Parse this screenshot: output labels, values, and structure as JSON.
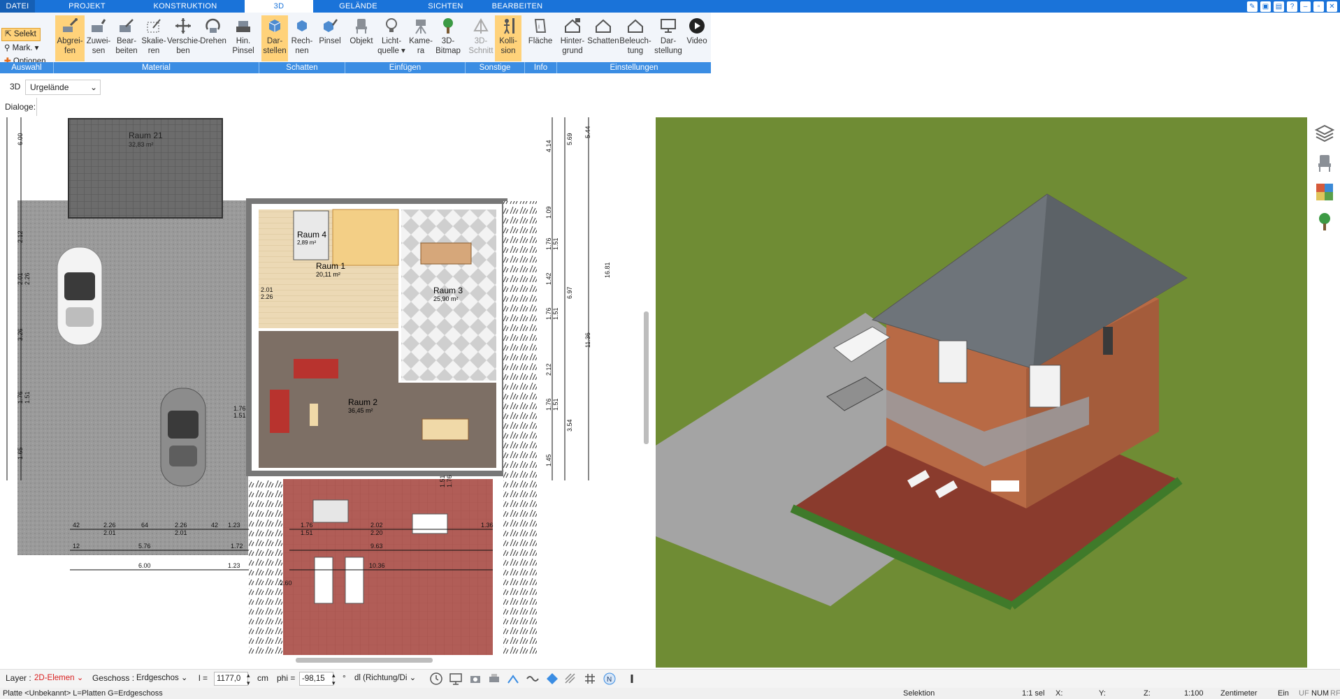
{
  "tabs": [
    "DATEI",
    "PROJEKT",
    "KONSTRUKTION",
    "3D",
    "GELÄNDE",
    "SICHTEN",
    "BEARBEITEN"
  ],
  "active_tab": "3D",
  "selection": {
    "select": "Selekt",
    "mark": "Mark.",
    "options": "Optionen"
  },
  "ribbon_buttons": [
    {
      "l1": "Abgrei-",
      "l2": "fen"
    },
    {
      "l1": "Zuwei-",
      "l2": "sen"
    },
    {
      "l1": "Bear-",
      "l2": "beiten"
    },
    {
      "l1": "Skalie-",
      "l2": "ren"
    },
    {
      "l1": "Verschie-",
      "l2": "ben"
    },
    {
      "l1": "Drehen",
      "l2": ""
    },
    {
      "l1": "Hin.",
      "l2": "Pinsel"
    },
    {
      "l1": "Dar-",
      "l2": "stellen"
    },
    {
      "l1": "Rech-",
      "l2": "nen"
    },
    {
      "l1": "Pinsel",
      "l2": ""
    },
    {
      "l1": "Objekt",
      "l2": ""
    },
    {
      "l1": "Licht-",
      "l2": "quelle"
    },
    {
      "l1": "Kame-",
      "l2": "ra"
    },
    {
      "l1": "3D-",
      "l2": "Bitmap"
    },
    {
      "l1": "3D-",
      "l2": "Schnitt"
    },
    {
      "l1": "Kolli-",
      "l2": "sion"
    },
    {
      "l1": "Fläche",
      "l2": ""
    },
    {
      "l1": "Hinter-",
      "l2": "grund"
    },
    {
      "l1": "Schatten",
      "l2": ""
    },
    {
      "l1": "Beleuch-",
      "l2": "tung"
    },
    {
      "l1": "Dar-",
      "l2": "stellung"
    },
    {
      "l1": "Video",
      "l2": ""
    }
  ],
  "groups": [
    "Auswahl",
    "Material",
    "Schatten",
    "Einfügen",
    "Sonstige",
    "Info",
    "Einstellungen"
  ],
  "view": {
    "mode": "3D",
    "combo": "Urgelände"
  },
  "dialoge_label": "Dialoge:",
  "rooms": [
    {
      "name": "Raum 21",
      "area": "32,83 m²"
    },
    {
      "name": "Raum 4",
      "area": "2,89 m²"
    },
    {
      "name": "Raum 1",
      "area": "20,11 m²"
    },
    {
      "name": "Raum 3",
      "area": "25,90 m²"
    },
    {
      "name": "Raum 2",
      "area": "36,45 m²"
    }
  ],
  "dims": {
    "left": [
      "6.00",
      "2.12",
      "2.01",
      "2.26",
      "3.26",
      "1.76",
      "1.51",
      "1.65"
    ],
    "right_a": [
      "4.14",
      "1.09",
      "1.76",
      "1.51",
      "1.42",
      "1.76",
      "1.51",
      "2.12",
      "1.76",
      "1.51",
      "1.45"
    ],
    "right_b": [
      "5.69",
      "6.97",
      "3.54"
    ],
    "right_c": [
      "5.44",
      "11.36",
      "16.81"
    ],
    "bottom_row1": [
      "42",
      "2.26",
      "64",
      "2.26",
      "42",
      "1.23",
      "1.76",
      "2.02",
      "1.36"
    ],
    "bottom_row2": [
      "2.01",
      "2.01",
      "1.51",
      "2.20"
    ],
    "bottom_row3": [
      "12",
      "5.76",
      "1.72",
      "9.63"
    ],
    "bottom_row4": [
      "6.00",
      "1.23",
      "10.36"
    ],
    "misc": [
      "2.01",
      "2.26",
      "1.76",
      "1.51",
      "2.60",
      "1.51",
      "1.76"
    ]
  },
  "bottom": {
    "layer_label": "Layer :",
    "layer_value": "2D-Elemen",
    "geschoss_label": "Geschoss :",
    "geschoss_value": "Erdgeschos",
    "l_label": "l =",
    "l_value": "1177,0",
    "unit": "cm",
    "phi_label": "phi =",
    "phi_value": "-98,15",
    "deg": "°",
    "dl_value": "dl (Richtung/Di"
  },
  "status": {
    "left": "Platte <Unbekannt> L=Platten G=Erdgeschoss",
    "mode": "Selektion",
    "sel": "1:1 sel",
    "x": "X:",
    "y": "Y:",
    "z": "Z:",
    "scale": "1:100",
    "unit": "Zentimeter",
    "ein": "Ein",
    "flags1": "UF",
    "flags2": "NUM",
    "flags3": "RF"
  },
  "colors": {
    "ribbon_blue": "#1a73d9",
    "group_blue": "#3b8de3",
    "active_orange": "#ffd27a",
    "grass": "#6f8c34",
    "terrace_red": "#9a3a30",
    "roof_gray": "#6e747a",
    "wall_brick": "#b86a45"
  },
  "icons": [
    "select-icon",
    "mark-icon",
    "options-icon",
    "layers-icon",
    "furniture-icon",
    "materials-icon",
    "plants-icon",
    "clock-icon",
    "monitor-icon",
    "camera-icon",
    "print-icon",
    "angle-icon",
    "wave-icon",
    "diamond-icon",
    "hatch-icon",
    "grid-icon",
    "north-icon",
    "more-icon"
  ]
}
